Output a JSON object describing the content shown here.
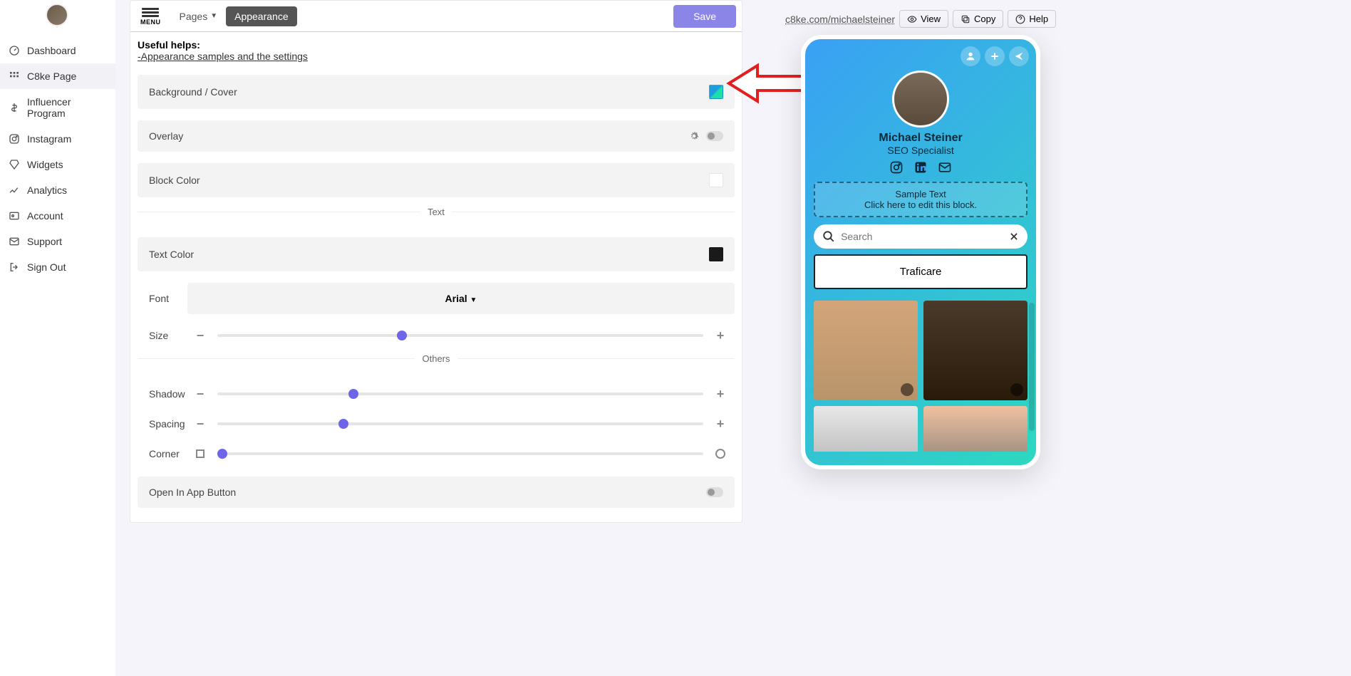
{
  "sidebar": {
    "items": [
      {
        "label": "Dashboard"
      },
      {
        "label": "C8ke Page"
      },
      {
        "label": "Influencer Program"
      },
      {
        "label": "Instagram"
      },
      {
        "label": "Widgets"
      },
      {
        "label": "Analytics"
      },
      {
        "label": "Account"
      },
      {
        "label": "Support"
      },
      {
        "label": "Sign Out"
      }
    ]
  },
  "topbar": {
    "menu_label": "MENU",
    "tab_pages": "Pages",
    "tab_appearance": "Appearance",
    "save": "Save"
  },
  "helps": {
    "title": "Useful helps:",
    "link": "-Appearance samples and the settings"
  },
  "settings": {
    "background": "Background / Cover",
    "overlay": "Overlay",
    "block_color": "Block Color",
    "section_text": "Text",
    "text_color": "Text Color",
    "font_label": "Font",
    "font_value": "Arial",
    "size": "Size",
    "section_others": "Others",
    "shadow": "Shadow",
    "spacing": "Spacing",
    "corner": "Corner",
    "open_in_app": "Open In App Button",
    "slider_positions": {
      "size": 38,
      "shadow": 28,
      "spacing": 26,
      "corner": 1
    }
  },
  "right": {
    "url": "c8ke.com/michaelsteiner",
    "view": "View",
    "copy": "Copy",
    "help": "Help"
  },
  "preview": {
    "name": "Michael Steiner",
    "subtitle": "SEO Specialist",
    "sample_l1": "Sample Text",
    "sample_l2": "Click here to edit this block.",
    "search_placeholder": "Search",
    "button": "Traficare"
  }
}
